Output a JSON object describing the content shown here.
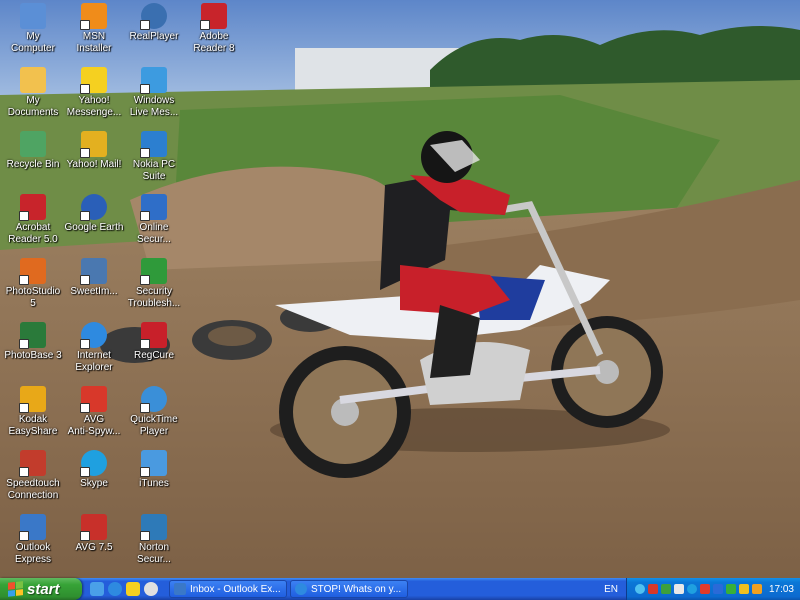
{
  "desktop": {
    "icons": [
      {
        "label": "My\nComputer",
        "icon": "my-computer-icon",
        "color": "#5b8fd6"
      },
      {
        "label": "My\nDocuments",
        "icon": "my-documents-icon",
        "color": "#f2c14e"
      },
      {
        "label": "Recycle Bin",
        "icon": "recycle-bin-icon",
        "color": "#4fa463"
      },
      {
        "label": "Acrobat\nReader 5.0",
        "icon": "acrobat-reader-icon",
        "color": "#c8242b"
      },
      {
        "label": "PhotoStudio\n5",
        "icon": "photostudio-icon",
        "color": "#e06a1f"
      },
      {
        "label": "PhotoBase 3",
        "icon": "photobase-icon",
        "color": "#2a7a3a"
      },
      {
        "label": "Kodak\nEasyShare",
        "icon": "kodak-easyshare-icon",
        "color": "#e8a818"
      },
      {
        "label": "Speedtouch\nConnection",
        "icon": "speedtouch-icon",
        "color": "#c23c2c"
      },
      {
        "label": "Outlook\nExpress",
        "icon": "outlook-express-icon",
        "color": "#3a78c8"
      },
      {
        "label": "MSN\nInstaller",
        "icon": "msn-installer-icon",
        "color": "#f08c1a"
      },
      {
        "label": "Yahoo!\nMessenge...",
        "icon": "yahoo-messenger-icon",
        "color": "#f5d020"
      },
      {
        "label": "Yahoo! Mail!",
        "icon": "yahoo-mail-icon",
        "color": "#e3b020"
      },
      {
        "label": "Google Earth",
        "icon": "google-earth-icon",
        "color": "#2a5fb8"
      },
      {
        "label": "SweetIm...",
        "icon": "sweetim-icon",
        "color": "#4a78b0"
      },
      {
        "label": "Internet\nExplorer",
        "icon": "internet-explorer-icon",
        "color": "#2e8ae0"
      },
      {
        "label": "AVG\nAnti-Spyw...",
        "icon": "avg-antispyware-icon",
        "color": "#d8382a"
      },
      {
        "label": "Skype",
        "icon": "skype-icon",
        "color": "#1fa0e0"
      },
      {
        "label": "AVG 7.5",
        "icon": "avg-icon",
        "color": "#c8302a"
      },
      {
        "label": "RealPlayer",
        "icon": "realplayer-icon",
        "color": "#3a6fb0"
      },
      {
        "label": "Windows\nLive Mes...",
        "icon": "windows-live-messenger-icon",
        "color": "#3d9be0"
      },
      {
        "label": "Nokia PC\nSuite",
        "icon": "nokia-pc-suite-icon",
        "color": "#2c7fd0"
      },
      {
        "label": "Online\nSecur...",
        "icon": "online-security-icon",
        "color": "#2f6ec8"
      },
      {
        "label": "Security\nTroublesh...",
        "icon": "security-troubleshooter-icon",
        "color": "#2f9a3a"
      },
      {
        "label": "RegCure",
        "icon": "regcure-icon",
        "color": "#c8202a"
      },
      {
        "label": "QuickTime\nPlayer",
        "icon": "quicktime-icon",
        "color": "#3a8fd8"
      },
      {
        "label": "iTunes",
        "icon": "itunes-icon",
        "color": "#4a9ae0"
      },
      {
        "label": "Norton\nSecur...",
        "icon": "norton-security-icon",
        "color": "#2e7ab8"
      },
      {
        "label": "Adobe\nReader 8",
        "icon": "adobe-reader-icon",
        "color": "#c8242b"
      }
    ]
  },
  "taskbar": {
    "start_label": "start",
    "quicklaunch": [
      {
        "icon": "show-desktop-icon",
        "color": "#4aa0e8"
      },
      {
        "icon": "internet-explorer-icon",
        "color": "#2e8ae0"
      },
      {
        "icon": "yahoo-messenger-icon",
        "color": "#f5d020"
      },
      {
        "icon": "windows-media-icon",
        "color": "#e0e0e0"
      }
    ],
    "tasks": [
      {
        "label": "Inbox - Outlook Ex...",
        "icon": "outlook-express-icon",
        "color": "#3a78c8"
      },
      {
        "label": "STOP! Whats on y...",
        "icon": "internet-explorer-icon",
        "color": "#2e8ae0"
      }
    ],
    "language": "EN",
    "tray_icons": [
      {
        "icon": "network-icon",
        "color": "#4fc0f0"
      },
      {
        "icon": "avg-tray-icon",
        "color": "#d8382a"
      },
      {
        "icon": "msn-tray-icon",
        "color": "#3da03d"
      },
      {
        "icon": "volume-icon",
        "color": "#e8e8e8"
      },
      {
        "icon": "skype-tray-icon",
        "color": "#1fa0e0"
      },
      {
        "icon": "security-tray-icon",
        "color": "#e23a2a"
      },
      {
        "icon": "bluetooth-icon",
        "color": "#2a6ad8"
      },
      {
        "icon": "messenger-tray-icon",
        "color": "#38b038"
      },
      {
        "icon": "norton-tray-icon",
        "color": "#f0c020"
      },
      {
        "icon": "update-tray-icon",
        "color": "#f0a020"
      }
    ],
    "clock": "17:03"
  }
}
